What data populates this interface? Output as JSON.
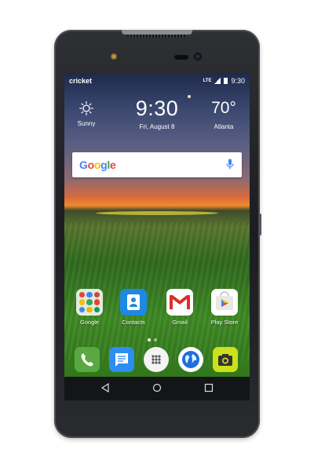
{
  "statusbar": {
    "carrier": "cricket",
    "network": "LTE",
    "time": "9:30"
  },
  "weather": {
    "condition": "Sunny",
    "time": "9:30",
    "date": "Fri, August 8",
    "temperature": "70°",
    "city": "Atlanta",
    "icon": "sun-icon"
  },
  "search": {
    "logo": [
      "G",
      "o",
      "o",
      "g",
      "l",
      "e"
    ],
    "mic_icon": "mic-icon"
  },
  "apps": [
    {
      "label": "Google",
      "icon": "google-folder-icon"
    },
    {
      "label": "Contacts",
      "icon": "contacts-icon"
    },
    {
      "label": "Gmail",
      "icon": "gmail-icon"
    },
    {
      "label": "Play Store",
      "icon": "play-store-icon"
    }
  ],
  "page_indicator": {
    "pages": 2,
    "current": 1
  },
  "dock": [
    {
      "icon": "phone-icon"
    },
    {
      "icon": "messaging-icon"
    },
    {
      "icon": "app-drawer-icon"
    },
    {
      "icon": "browser-icon"
    },
    {
      "icon": "camera-icon"
    }
  ],
  "navbar": {
    "back_icon": "back-icon",
    "home_icon": "home-icon",
    "recents_icon": "recents-icon"
  },
  "colors": {
    "phone_body": "#1c1d20",
    "google_blue": "#4285f4",
    "google_red": "#ea4335",
    "google_yellow": "#fbbc05",
    "google_green": "#34a853",
    "phone_app": "#5aa841",
    "messaging_app": "#2c8ef0",
    "camera_app": "#cde018"
  }
}
